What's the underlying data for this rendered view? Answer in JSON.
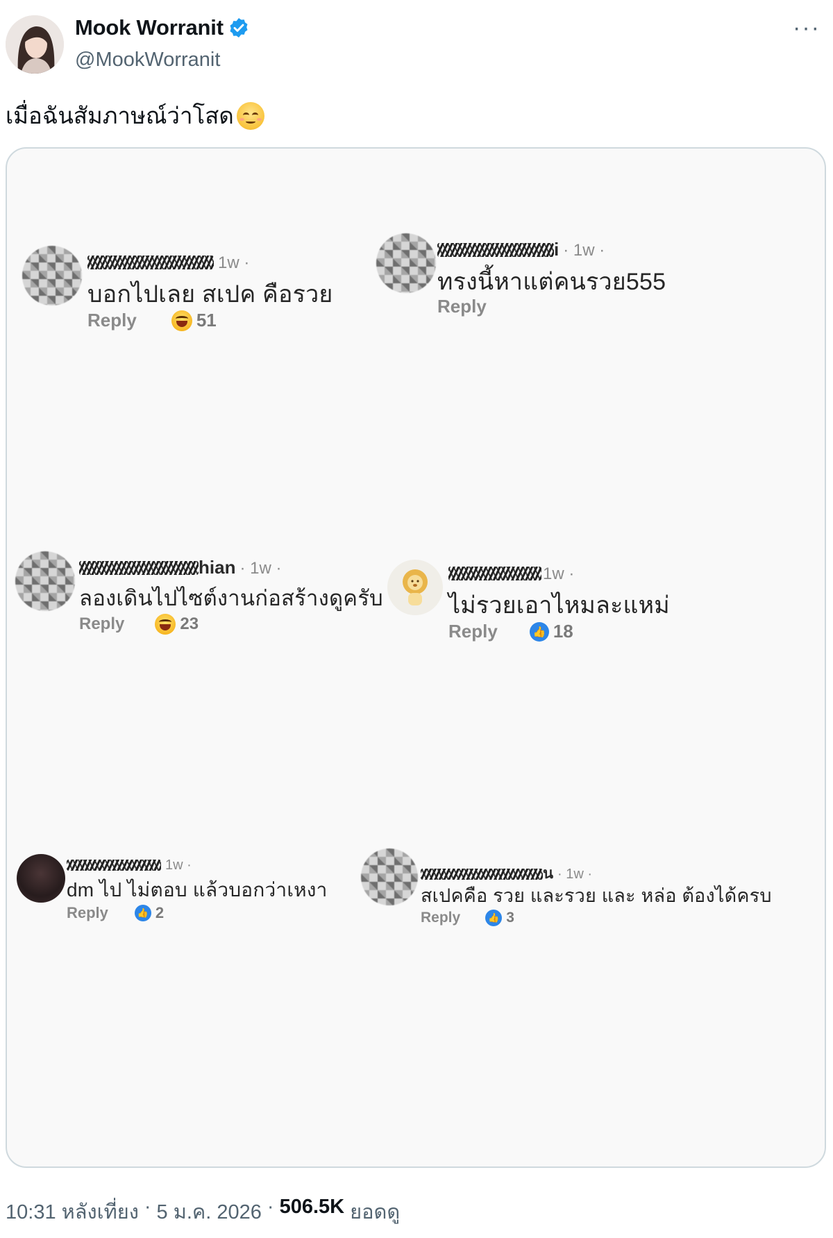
{
  "tweet": {
    "display_name": "Mook Worranit",
    "handle": "@MookWorranit",
    "text": "เมื่อฉันสัมภาษณ์ว่าโสด",
    "icons": {
      "verified": "verified-badge-icon",
      "more": "more-icon",
      "emoji": "pleading-face-emoji"
    },
    "colors": {
      "verified": "#1d9bf0",
      "text": "#0f1419",
      "secondary": "#536471"
    }
  },
  "media": {
    "comments": [
      {
        "username_suffix": "",
        "time": "1w ·",
        "text": "บอกไปเลย สเปค คือรวย",
        "reply": "Reply",
        "reaction": "laugh-emoji",
        "count": "51"
      },
      {
        "username_suffix": "i",
        "time": "· 1w ·",
        "text": "ทรงนี้หาแต่คนรวย555",
        "reply": "Reply",
        "reaction": "",
        "count": ""
      },
      {
        "username_suffix": "hian",
        "time": "· 1w ·",
        "text": "ลองเดินไปไซต์งานก่อสร้างดูครับ",
        "reply": "Reply",
        "reaction": "laugh-emoji",
        "count": "23"
      },
      {
        "username_suffix": "",
        "time": "1w ·",
        "text": "ไม่รวยเอาไหมละแหม่",
        "reply": "Reply",
        "reaction": "like-icon",
        "count": "18"
      },
      {
        "username_suffix": "",
        "time": "1w ·",
        "text": "dm ไป ไม่ตอบ แล้วบอกว่าเหงา",
        "reply": "Reply",
        "reaction": "like-icon",
        "count": "2"
      },
      {
        "username_suffix": "น",
        "time": "· 1w ·",
        "text": "สเปคคือ รวย และรวย และ หล่อ ต้องได้ครบ",
        "reply": "Reply",
        "reaction": "like-icon",
        "count": "3"
      }
    ]
  },
  "footer": {
    "time": "10:31 หลังเที่ยง",
    "sep1": "·",
    "date": "5 ม.ค. 2026",
    "sep2": "·",
    "views": "506.5K",
    "views_label": "ยอดดู"
  }
}
